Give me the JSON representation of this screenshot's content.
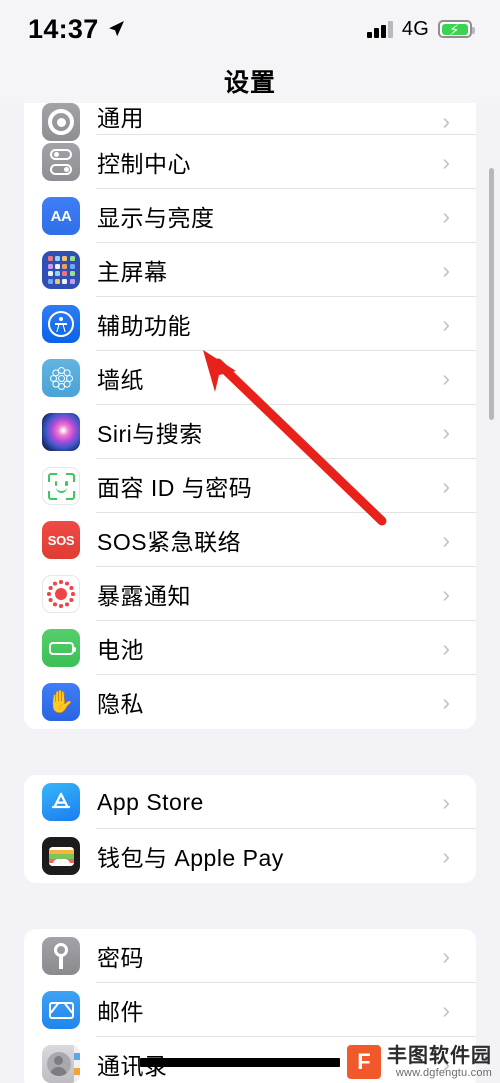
{
  "status_bar": {
    "time": "14:37",
    "location_icon": "location-arrow-icon",
    "signal_icon": "cellular-signal-icon",
    "network": "4G",
    "battery_icon": "battery-charging-icon"
  },
  "nav": {
    "title": "设置"
  },
  "sections": [
    {
      "name": "system-settings-group",
      "rows": [
        {
          "label": "通用",
          "icon": "gear-icon",
          "icon_class": "ic-general",
          "clipped": true
        },
        {
          "label": "控制中心",
          "icon": "control-center-icon",
          "icon_class": "ic-control"
        },
        {
          "label": "显示与亮度",
          "icon": "display-brightness-icon",
          "icon_class": "ic-display"
        },
        {
          "label": "主屏幕",
          "icon": "home-screen-icon",
          "icon_class": "ic-home"
        },
        {
          "label": "辅助功能",
          "icon": "accessibility-icon",
          "icon_class": "ic-access"
        },
        {
          "label": "墙纸",
          "icon": "wallpaper-icon",
          "icon_class": "ic-wall"
        },
        {
          "label": "Siri与搜索",
          "icon": "siri-icon",
          "icon_class": "ic-siri"
        },
        {
          "label": "面容 ID 与密码",
          "icon": "face-id-icon",
          "icon_class": "ic-faceid"
        },
        {
          "label": "SOS紧急联络",
          "icon": "sos-icon",
          "icon_class": "ic-sos"
        },
        {
          "label": "暴露通知",
          "icon": "exposure-notification-icon",
          "icon_class": "ic-expo"
        },
        {
          "label": "电池",
          "icon": "battery-icon",
          "icon_class": "ic-batt"
        },
        {
          "label": "隐私",
          "icon": "privacy-hand-icon",
          "icon_class": "ic-priv"
        }
      ]
    },
    {
      "name": "store-group",
      "rows": [
        {
          "label": "App Store",
          "icon": "app-store-icon",
          "icon_class": "ic-appstore"
        },
        {
          "label": "钱包与 Apple Pay",
          "icon": "wallet-icon",
          "icon_class": "ic-wallet"
        }
      ]
    },
    {
      "name": "apps-group",
      "rows": [
        {
          "label": "密码",
          "icon": "passwords-key-icon",
          "icon_class": "ic-pass"
        },
        {
          "label": "邮件",
          "icon": "mail-envelope-icon",
          "icon_class": "ic-mail"
        },
        {
          "label": "通讯录",
          "icon": "contacts-icon",
          "icon_class": "ic-contacts"
        }
      ]
    }
  ],
  "chevron": "›",
  "annotation": {
    "arrow_color": "#e8211b",
    "points_to": "辅助功能"
  },
  "watermark": {
    "mark": "F",
    "name": "丰图软件园",
    "url": "www.dgfengtu.com"
  }
}
